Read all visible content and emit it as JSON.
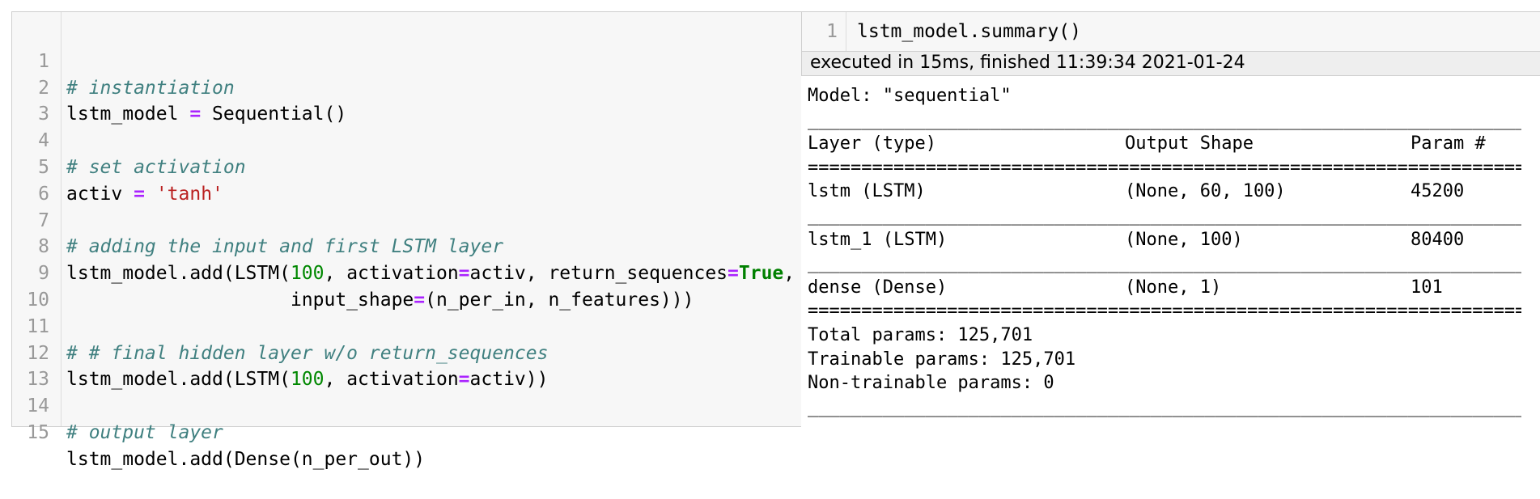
{
  "left_cell": {
    "lines": [
      {
        "n": "1"
      },
      {
        "n": "2"
      },
      {
        "n": "3"
      },
      {
        "n": "4"
      },
      {
        "n": "5"
      },
      {
        "n": "6"
      },
      {
        "n": "7"
      },
      {
        "n": "8"
      },
      {
        "n": "9"
      },
      {
        "n": "10"
      },
      {
        "n": "11"
      },
      {
        "n": "12"
      },
      {
        "n": "13"
      },
      {
        "n": "14"
      },
      {
        "n": "15"
      }
    ],
    "code": {
      "l1_comment": "# instantiation",
      "l2_a": "lstm_model ",
      "l2_op": "=",
      "l2_b": " Sequential()",
      "l4_comment": "# set activation",
      "l5_a": "activ ",
      "l5_op": "=",
      "l5_sp": " ",
      "l5_str": "'tanh'",
      "l7_comment": "# adding the input and first LSTM layer",
      "l8_a": "lstm_model.add(LSTM(",
      "l8_num": "100",
      "l8_b": ", activation",
      "l8_op1": "=",
      "l8_c": "activ, return_sequences",
      "l8_op2": "=",
      "l8_kw": "True",
      "l8_d": ",",
      "l9_a": "                    input_shape",
      "l9_op": "=",
      "l9_b": "(n_per_in, n_features)))",
      "l11_comment": "# # final hidden layer w/o return_sequences",
      "l12_a": "lstm_model.add(LSTM(",
      "l12_num": "100",
      "l12_b": ", activation",
      "l12_op": "=",
      "l12_c": "activ))",
      "l14_comment": "# output layer",
      "l15_a": "lstm_model.add(Dense(n_per_out))"
    }
  },
  "right_cell": {
    "line_number": "1",
    "code": "lstm_model.summary()",
    "exec_status": "executed in 15ms, finished 11:39:34 2021-01-24"
  },
  "summary": {
    "model_line": "Model: \"sequential\"",
    "rule_underscore": "________________________________________________________________________________________",
    "rule_equals": "========================================================================================",
    "headers": {
      "layer": "Layer (type)",
      "shape": "Output Shape",
      "params": "Param #"
    },
    "rows": [
      {
        "layer": "lstm (LSTM)",
        "shape": "(None, 60, 100)",
        "params": "45200"
      },
      {
        "layer": "lstm_1 (LSTM)",
        "shape": "(None, 100)",
        "params": "80400"
      },
      {
        "layer": "dense (Dense)",
        "shape": "(None, 1)",
        "params": "101"
      }
    ],
    "total": "Total params: 125,701",
    "trainable": "Trainable params: 125,701",
    "non_trainable": "Non-trainable params: 0"
  }
}
